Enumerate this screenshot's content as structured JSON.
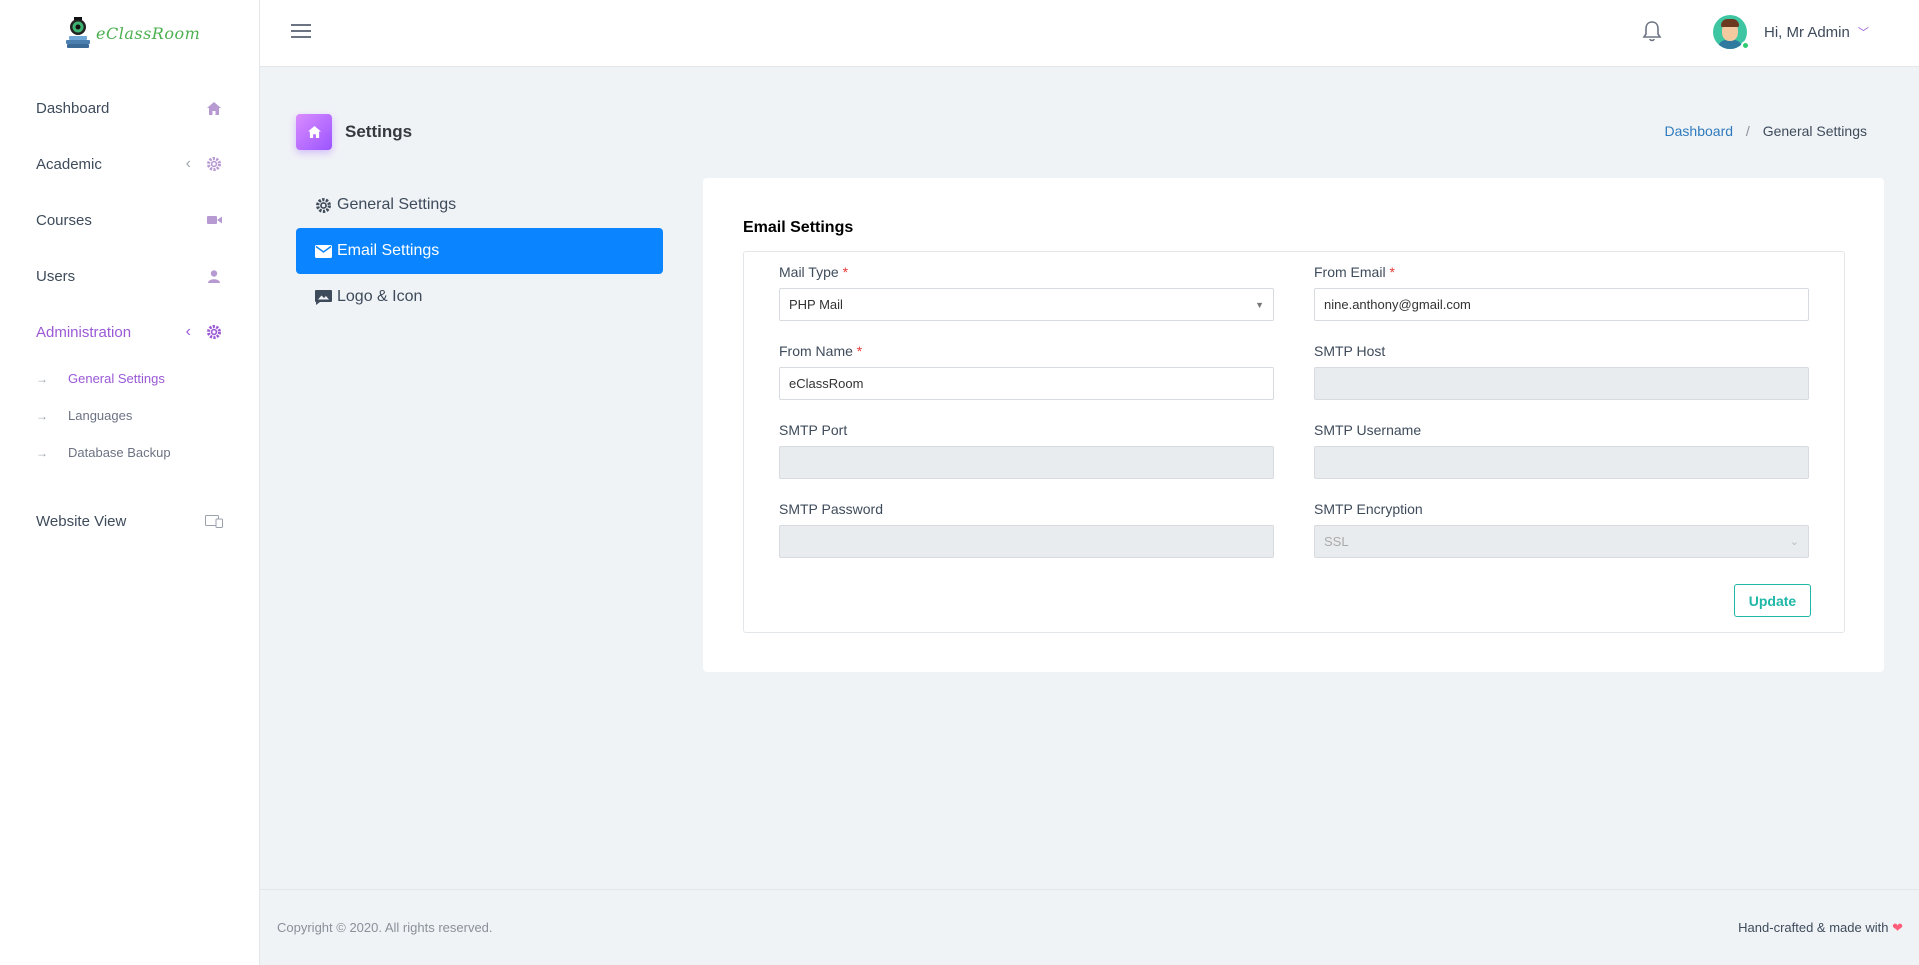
{
  "app": {
    "logo_text": "eClassRoom"
  },
  "sidebar": {
    "items": [
      {
        "label": "Dashboard",
        "icon": "home-icon"
      },
      {
        "label": "Academic",
        "icon": "gear-icon",
        "caret": "‹"
      },
      {
        "label": "Courses",
        "icon": "video-icon"
      },
      {
        "label": "Users",
        "icon": "user-icon"
      },
      {
        "label": "Administration",
        "icon": "gear-icon",
        "caret": "‹"
      }
    ],
    "sub_items": [
      {
        "label": "General Settings"
      },
      {
        "label": "Languages"
      },
      {
        "label": "Database Backup"
      }
    ],
    "website_view": {
      "label": "Website View",
      "icon": "devices-icon"
    }
  },
  "header": {
    "user_greeting": "Hi, Mr Admin",
    "user_caret": "﹀"
  },
  "page": {
    "title": "Settings",
    "breadcrumb": {
      "home": "Dashboard",
      "separator": "/",
      "current": "General Settings"
    }
  },
  "settings_nav": {
    "items": [
      {
        "label": "General Settings",
        "icon": "gear-icon"
      },
      {
        "label": "Email Settings",
        "icon": "envelope-icon"
      },
      {
        "label": "Logo & Icon",
        "icon": "image-icon"
      }
    ]
  },
  "form": {
    "title": "Email Settings",
    "required_mark": "*",
    "mail_type": {
      "label": "Mail Type",
      "value": "PHP Mail"
    },
    "from_email": {
      "label": "From Email",
      "value": "nine.anthony@gmail.com"
    },
    "from_name": {
      "label": "From Name",
      "value": "eClassRoom"
    },
    "smtp_host": {
      "label": "SMTP Host",
      "value": ""
    },
    "smtp_port": {
      "label": "SMTP Port",
      "value": ""
    },
    "smtp_username": {
      "label": "SMTP Username",
      "value": ""
    },
    "smtp_password": {
      "label": "SMTP Password",
      "value": ""
    },
    "smtp_encryption": {
      "label": "SMTP Encryption",
      "value": "SSL"
    },
    "update_label": "Update"
  },
  "footer": {
    "copyright": "Copyright © 2020. All rights reserved.",
    "made_with": "Hand-crafted & made with",
    "heart": "❤"
  },
  "colors": {
    "accent_purple": "#9b59d6",
    "active_blue": "#0a84ff",
    "update_teal": "#1fb7a6",
    "required_red": "#e53935"
  }
}
